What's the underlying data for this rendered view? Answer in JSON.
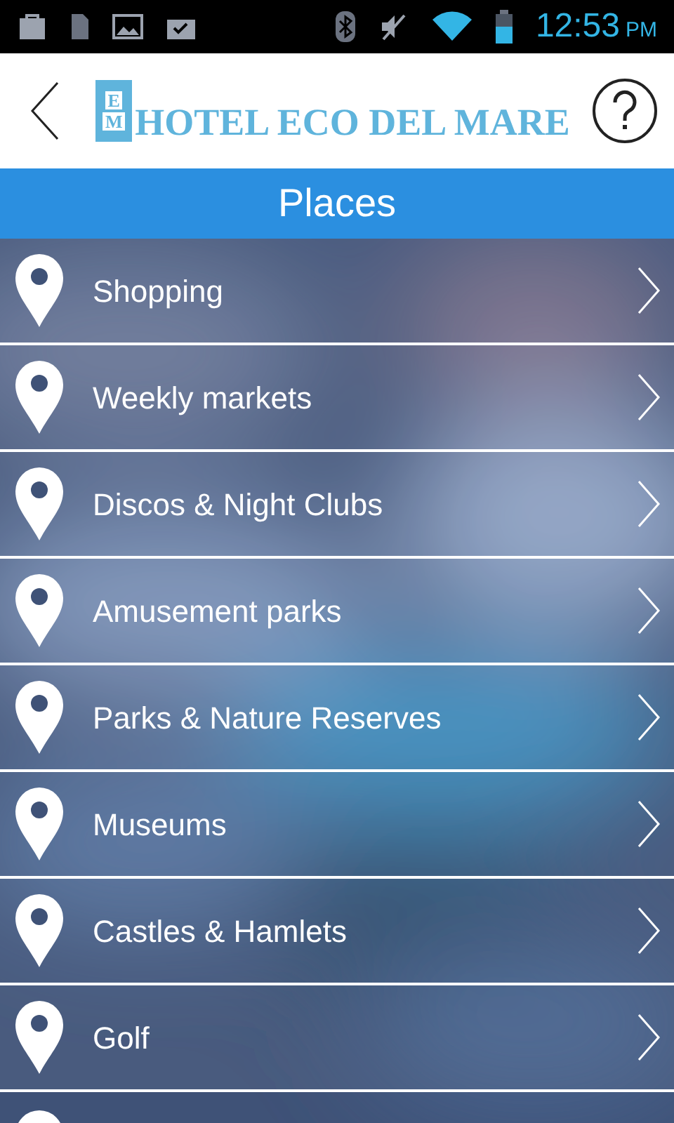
{
  "status_bar": {
    "time": "12:53",
    "meridiem": "PM"
  },
  "header": {
    "monogram": [
      "E",
      "M"
    ],
    "logo": "HOTEL ECO DEL MARE"
  },
  "title": "Places",
  "places": [
    {
      "label": "Shopping"
    },
    {
      "label": "Weekly markets"
    },
    {
      "label": "Discos & Night Clubs"
    },
    {
      "label": "Amusement parks"
    },
    {
      "label": "Parks & Nature Reserves"
    },
    {
      "label": "Museums"
    },
    {
      "label": "Castles & Hamlets"
    },
    {
      "label": "Golf"
    }
  ]
}
